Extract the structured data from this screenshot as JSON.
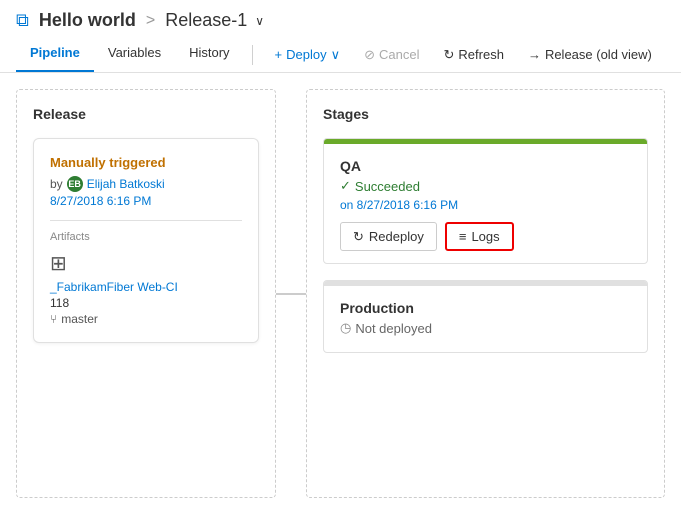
{
  "header": {
    "app_title": "Hello world",
    "breadcrumb_sep": ">",
    "release_name": "Release-1"
  },
  "nav": {
    "tabs": [
      {
        "id": "pipeline",
        "label": "Pipeline",
        "active": true
      },
      {
        "id": "variables",
        "label": "Variables",
        "active": false
      },
      {
        "id": "history",
        "label": "History",
        "active": false
      }
    ],
    "actions": [
      {
        "id": "deploy",
        "label": "Deploy",
        "icon": "+"
      },
      {
        "id": "cancel",
        "label": "Cancel",
        "icon": "⊘"
      },
      {
        "id": "refresh",
        "label": "Refresh",
        "icon": "↻"
      },
      {
        "id": "old_view",
        "label": "Release (old view)",
        "icon": "→"
      }
    ]
  },
  "release_panel": {
    "title": "Release",
    "card": {
      "trigger": "Manually triggered",
      "by_label": "by",
      "user_initials": "EB",
      "user_name": "Elijah Batkoski",
      "trigger_time": "8/27/2018 6:16 PM",
      "artifacts_label": "Artifacts",
      "artifact_name": "_FabrikamFiber Web-CI",
      "artifact_build": "118",
      "artifact_branch": "master"
    }
  },
  "stages_panel": {
    "title": "Stages",
    "stages": [
      {
        "id": "qa",
        "name": "QA",
        "status": "Succeeded",
        "status_type": "success",
        "time": "on 8/27/2018 6:16 PM",
        "actions": [
          {
            "id": "redeploy",
            "label": "Redeploy",
            "icon": "↻"
          },
          {
            "id": "logs",
            "label": "Logs",
            "icon": "≡",
            "highlighted": true
          }
        ]
      },
      {
        "id": "production",
        "name": "Production",
        "status": "Not deployed",
        "status_type": "not-deployed",
        "time": "",
        "actions": []
      }
    ]
  }
}
